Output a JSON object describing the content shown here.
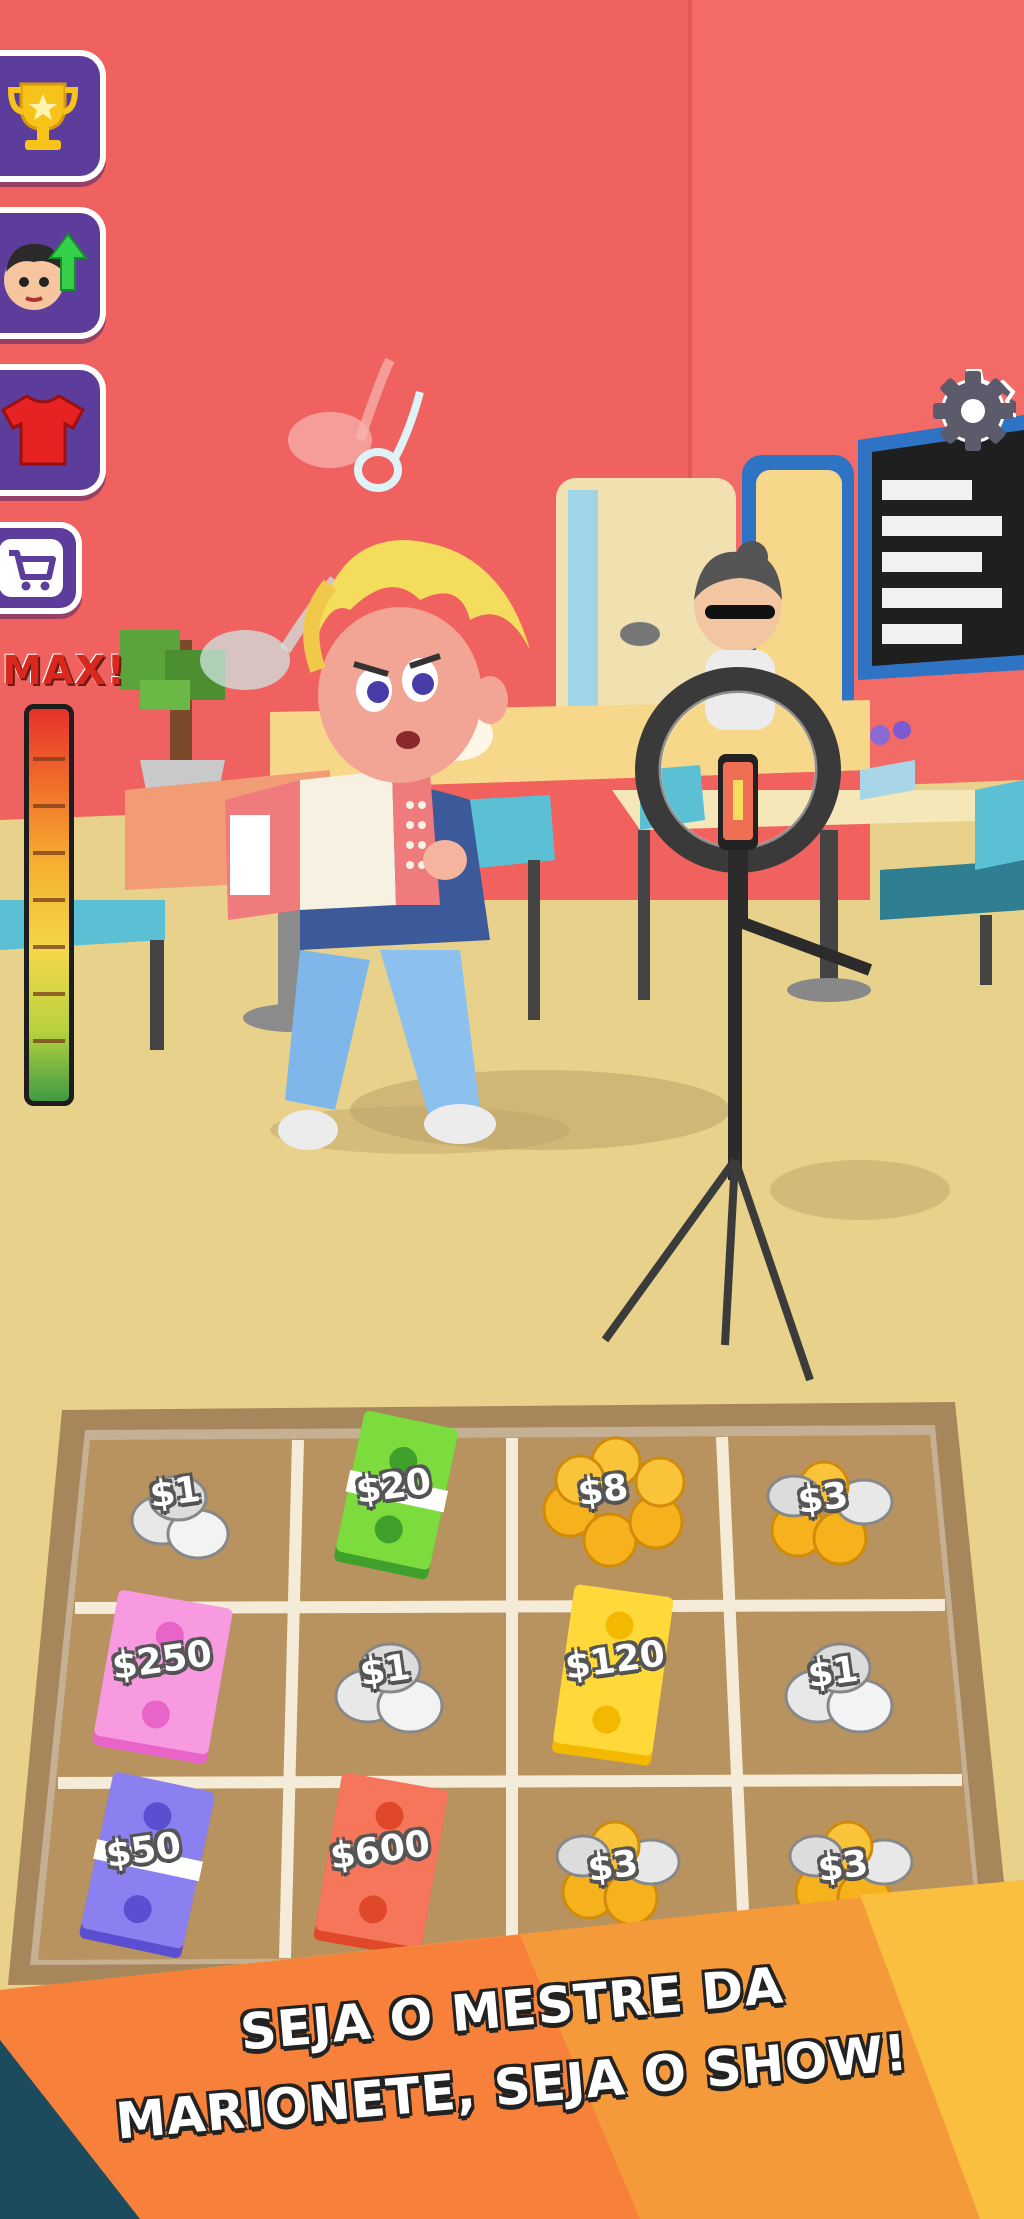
{
  "hud": {
    "meter_label": "MAX!",
    "meter_level": 1.0,
    "buttons": [
      "trophy-icon",
      "character-upgrade-icon",
      "tshirt-icon",
      "cart-icon"
    ],
    "settings_icon": "gear-icon"
  },
  "tray": {
    "cells": [
      {
        "label": "$1",
        "item": "silver-coins"
      },
      {
        "label": "$20",
        "item": "green-banknotes"
      },
      {
        "label": "$8",
        "item": "gold-coins"
      },
      {
        "label": "$3",
        "item": "mixed-coins"
      },
      {
        "label": "$250",
        "item": "pink-banknotes"
      },
      {
        "label": "$1",
        "item": "silver-coins"
      },
      {
        "label": "$120",
        "item": "yellow-banknotes"
      },
      {
        "label": "$1",
        "item": "silver-coins"
      },
      {
        "label": "$50",
        "item": "blue-banknotes"
      },
      {
        "label": "$600",
        "item": "red-banknotes"
      },
      {
        "label": "$3",
        "item": "mixed-coins"
      },
      {
        "label": "$3",
        "item": "mixed-coins"
      }
    ]
  },
  "banner": {
    "line1": "SEJA O MESTRE DA",
    "line2": "MARIONETE, SEJA O SHOW!"
  },
  "colors": {
    "wall": "#f0625f",
    "floor": "#e8d18a",
    "hud_purple": "#5d3d9b",
    "banner_orange": "#f7932e",
    "banner_dark": "#1d4b5e"
  }
}
